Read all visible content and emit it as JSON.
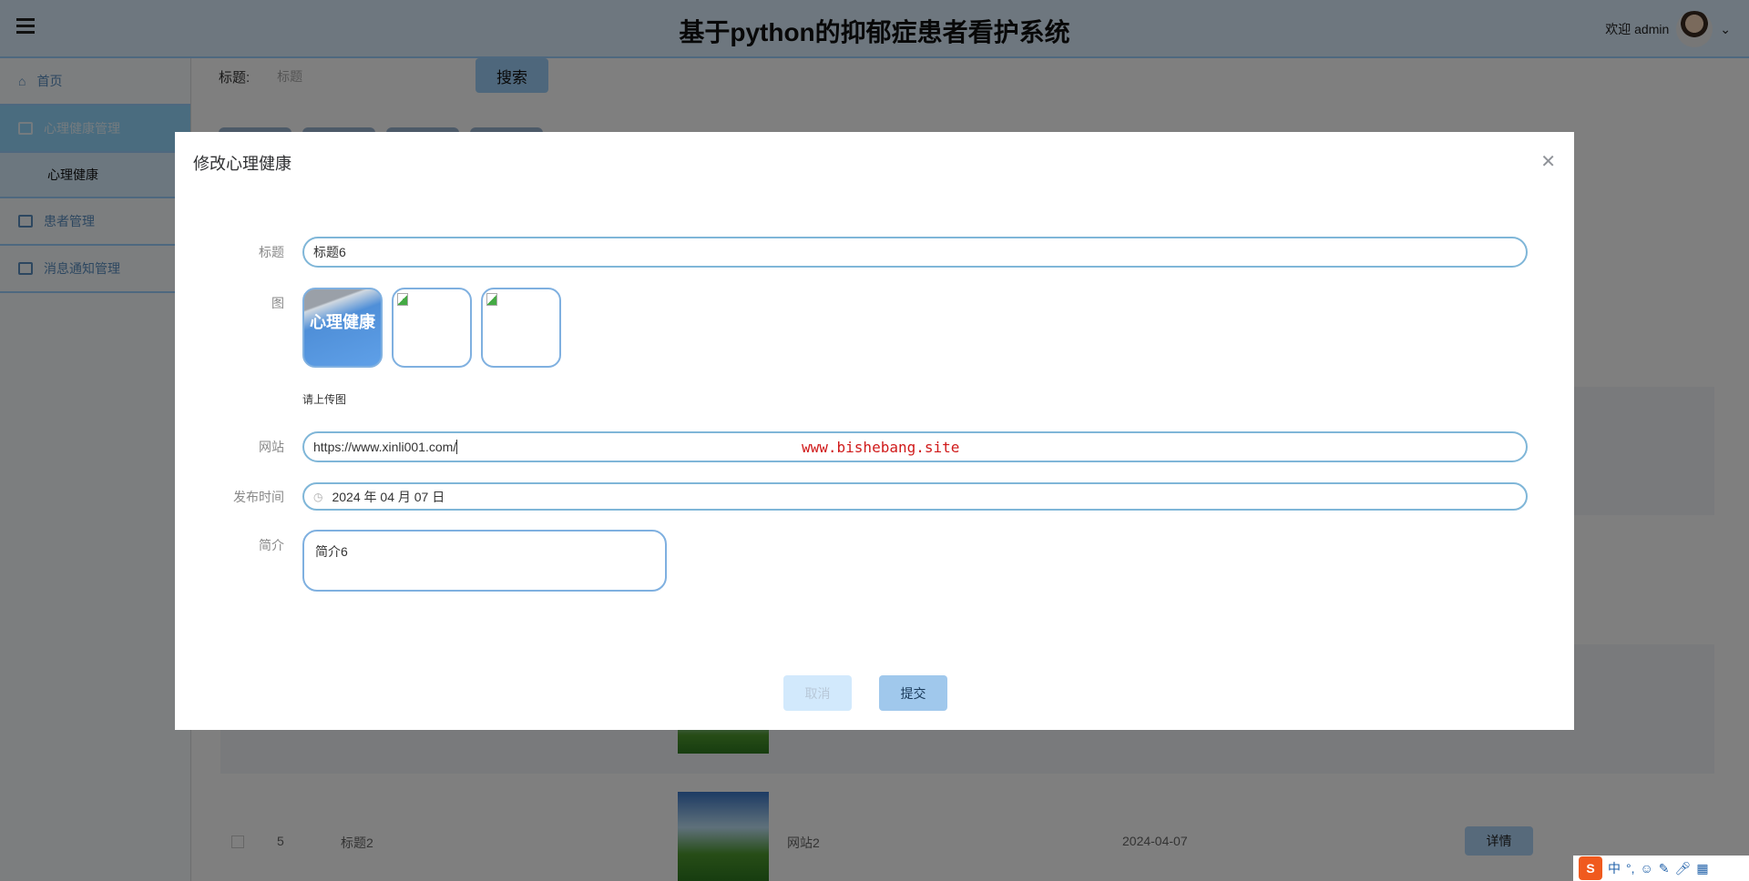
{
  "header": {
    "title": "基于python的抑郁症患者看护系统",
    "welcome": "欢迎 admin"
  },
  "sidebar": {
    "items": [
      {
        "label": "首页"
      },
      {
        "label": "心理健康管理",
        "sub": [
          "心理健康"
        ]
      },
      {
        "label": "患者管理"
      },
      {
        "label": "消息通知管理"
      }
    ]
  },
  "search": {
    "label": "标题:",
    "placeholder": "标题",
    "button": "搜索"
  },
  "table": {
    "visible_row": {
      "index": "5",
      "title": "标题2",
      "site": "网站2",
      "date": "2024-04-07",
      "action": "详情"
    }
  },
  "dialog": {
    "title": "修改心理健康",
    "fields": {
      "title": {
        "label": "标题",
        "value": "标题6"
      },
      "image": {
        "label": "图",
        "hint": "请上传图",
        "image_text": "心理健康"
      },
      "site": {
        "label": "网站",
        "value": "https://www.xinli001.com/"
      },
      "date": {
        "label": "发布时间",
        "value": "2024 年 04 月 07 日"
      },
      "intro": {
        "label": "简介",
        "value": "简介6"
      }
    },
    "cancel": "取消",
    "submit": "提交"
  },
  "watermark": "www.bishebang.site",
  "ime": {
    "mode": "中",
    "punct": "°,"
  }
}
